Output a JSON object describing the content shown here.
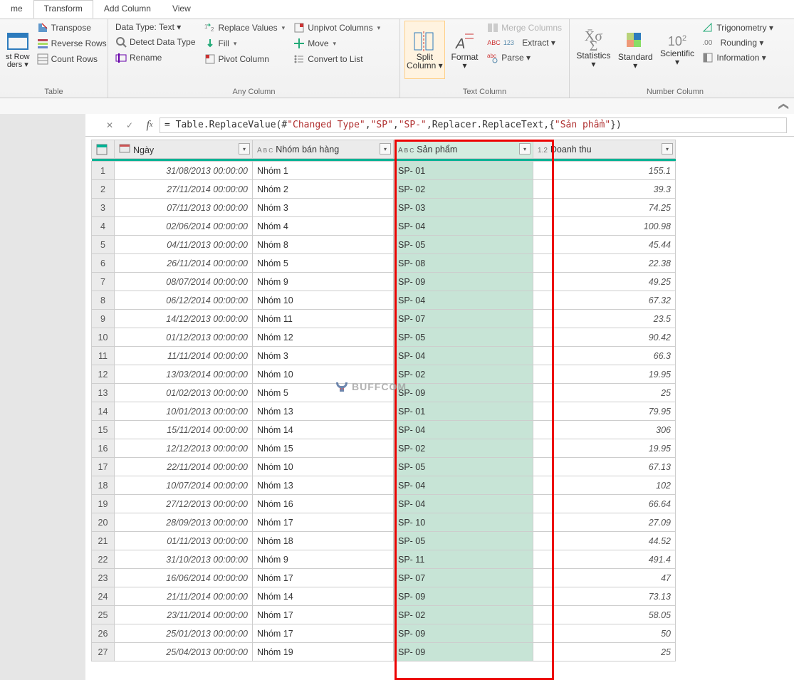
{
  "tabs": [
    "me",
    "Transform",
    "Add Column",
    "View"
  ],
  "ribbon": {
    "table_group": {
      "label": "Table",
      "left_big": "st Row\nders ▾",
      "transpose": "Transpose",
      "reverse": "Reverse Rows",
      "count": "Count Rows"
    },
    "anycol": {
      "label": "Any Column",
      "datatype": "Data Type: Text ▾",
      "detect": "Detect Data Type",
      "rename": "Rename",
      "replace": "Replace Values",
      "fill": "Fill",
      "pivot": "Pivot Column",
      "unpivot": "Unpivot Columns",
      "move": "Move",
      "tolist": "Convert to List"
    },
    "textcol": {
      "label": "Text Column",
      "split": "Split\nColumn ▾",
      "format": "Format\n▾",
      "merge": "Merge Columns",
      "extract": "Extract ▾",
      "parse": "Parse ▾"
    },
    "numcol": {
      "label": "Number Column",
      "stats": "Statistics\n▾",
      "standard": "Standard\n▾",
      "sci": "Scientific\n▾",
      "trig": "Trigonometry ▾",
      "round": "Rounding ▾",
      "info": "Information ▾",
      "ten": "10",
      "two": "2"
    }
  },
  "formula": {
    "prefix": "= Table.ReplaceValue(#",
    "changed": "\"Changed Type\"",
    "sp": "\"SP\"",
    "sp2": "\"SP-\"",
    "replacer": ",Replacer.ReplaceText,{",
    "sanpham": "\"Sản phẩm\"",
    "end": "})"
  },
  "columns": {
    "c1": "Ngày",
    "c2": "Nhóm bán hàng",
    "c3": "Sản phẩm",
    "c4": "Doanh thu",
    "abc": "ABC",
    "num": "1.2"
  },
  "rows": [
    {
      "n": 1,
      "d": "31/08/2013 00:00:00",
      "g": "Nhóm 1",
      "p": "SP- 01",
      "v": "155.1"
    },
    {
      "n": 2,
      "d": "27/11/2014 00:00:00",
      "g": "Nhóm 2",
      "p": "SP- 02",
      "v": "39.3"
    },
    {
      "n": 3,
      "d": "07/11/2013 00:00:00",
      "g": "Nhóm 3",
      "p": "SP- 03",
      "v": "74.25"
    },
    {
      "n": 4,
      "d": "02/06/2014 00:00:00",
      "g": "Nhóm 4",
      "p": "SP- 04",
      "v": "100.98"
    },
    {
      "n": 5,
      "d": "04/11/2013 00:00:00",
      "g": "Nhóm 8",
      "p": "SP- 05",
      "v": "45.44"
    },
    {
      "n": 6,
      "d": "26/11/2014 00:00:00",
      "g": "Nhóm 5",
      "p": "SP- 08",
      "v": "22.38"
    },
    {
      "n": 7,
      "d": "08/07/2014 00:00:00",
      "g": "Nhóm 9",
      "p": "SP- 09",
      "v": "49.25"
    },
    {
      "n": 8,
      "d": "06/12/2014 00:00:00",
      "g": "Nhóm 10",
      "p": "SP- 04",
      "v": "67.32"
    },
    {
      "n": 9,
      "d": "14/12/2013 00:00:00",
      "g": "Nhóm 11",
      "p": "SP- 07",
      "v": "23.5"
    },
    {
      "n": 10,
      "d": "01/12/2013 00:00:00",
      "g": "Nhóm 12",
      "p": "SP- 05",
      "v": "90.42"
    },
    {
      "n": 11,
      "d": "11/11/2014 00:00:00",
      "g": "Nhóm 3",
      "p": "SP- 04",
      "v": "66.3"
    },
    {
      "n": 12,
      "d": "13/03/2014 00:00:00",
      "g": "Nhóm 10",
      "p": "SP- 02",
      "v": "19.95"
    },
    {
      "n": 13,
      "d": "01/02/2013 00:00:00",
      "g": "Nhóm 5",
      "p": "SP- 09",
      "v": "25"
    },
    {
      "n": 14,
      "d": "10/01/2013 00:00:00",
      "g": "Nhóm 13",
      "p": "SP- 01",
      "v": "79.95"
    },
    {
      "n": 15,
      "d": "15/11/2014 00:00:00",
      "g": "Nhóm 14",
      "p": "SP- 04",
      "v": "306"
    },
    {
      "n": 16,
      "d": "12/12/2013 00:00:00",
      "g": "Nhóm 15",
      "p": "SP- 02",
      "v": "19.95"
    },
    {
      "n": 17,
      "d": "22/11/2014 00:00:00",
      "g": "Nhóm 10",
      "p": "SP- 05",
      "v": "67.13"
    },
    {
      "n": 18,
      "d": "10/07/2014 00:00:00",
      "g": "Nhóm 13",
      "p": "SP- 04",
      "v": "102"
    },
    {
      "n": 19,
      "d": "27/12/2013 00:00:00",
      "g": "Nhóm 16",
      "p": "SP- 04",
      "v": "66.64"
    },
    {
      "n": 20,
      "d": "28/09/2013 00:00:00",
      "g": "Nhóm 17",
      "p": "SP- 10",
      "v": "27.09"
    },
    {
      "n": 21,
      "d": "01/11/2013 00:00:00",
      "g": "Nhóm 18",
      "p": "SP- 05",
      "v": "44.52"
    },
    {
      "n": 22,
      "d": "31/10/2013 00:00:00",
      "g": "Nhóm 9",
      "p": "SP- 11",
      "v": "491.4"
    },
    {
      "n": 23,
      "d": "16/06/2014 00:00:00",
      "g": "Nhóm 17",
      "p": "SP- 07",
      "v": "47"
    },
    {
      "n": 24,
      "d": "21/11/2014 00:00:00",
      "g": "Nhóm 14",
      "p": "SP- 09",
      "v": "73.13"
    },
    {
      "n": 25,
      "d": "23/11/2014 00:00:00",
      "g": "Nhóm 17",
      "p": "SP- 02",
      "v": "58.05"
    },
    {
      "n": 26,
      "d": "25/01/2013 00:00:00",
      "g": "Nhóm 17",
      "p": "SP- 09",
      "v": "50"
    },
    {
      "n": 27,
      "d": "25/04/2013 00:00:00",
      "g": "Nhóm 19",
      "p": "SP- 09",
      "v": "25"
    }
  ],
  "watermark": "BUFFCOM"
}
